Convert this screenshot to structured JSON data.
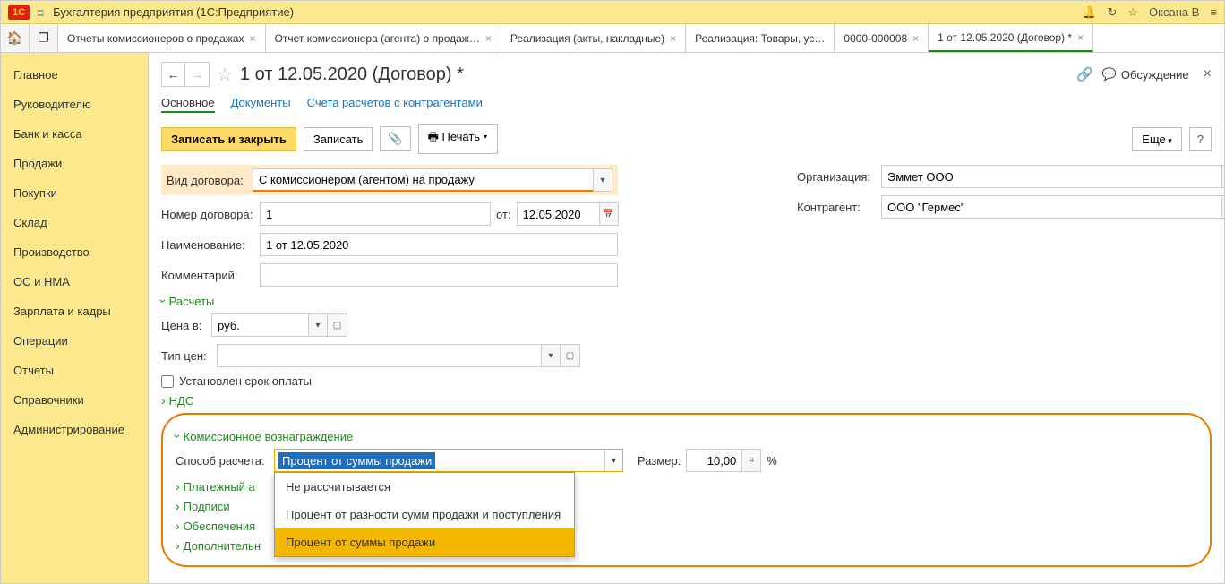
{
  "top": {
    "title": "Бухгалтерия предприятия  (1С:Предприятие)",
    "user": "Оксана В"
  },
  "tabs": [
    {
      "label": "Отчеты комиссионеров о продажах"
    },
    {
      "label": "Отчет комиссионера (агента) о продаж…"
    },
    {
      "label": "Реализация (акты, накладные)"
    },
    {
      "label": "Реализация: Товары, ус…"
    },
    {
      "label": "0000-000008"
    },
    {
      "label": "1 от 12.05.2020 (Договор) *"
    }
  ],
  "nav": [
    "Главное",
    "Руководителю",
    "Банк и касса",
    "Продажи",
    "Покупки",
    "Склад",
    "Производство",
    "ОС и НМА",
    "Зарплата и кадры",
    "Операции",
    "Отчеты",
    "Справочники",
    "Администрирование"
  ],
  "page": {
    "title": "1 от 12.05.2020 (Договор) *",
    "discuss": "Обсуждение"
  },
  "subtabs": {
    "main": "Основное",
    "docs": "Документы",
    "accounts": "Счета расчетов с контрагентами"
  },
  "toolbar": {
    "save_close": "Записать и закрыть",
    "save": "Записать",
    "print": "Печать",
    "more": "Еще"
  },
  "labels": {
    "contract_type": "Вид договора:",
    "org": "Организация:",
    "number": "Номер договора:",
    "from": "от:",
    "counterparty": "Контрагент:",
    "name": "Наименование:",
    "comment": "Комментарий:",
    "calc": "Расчеты",
    "price_in": "Цена в:",
    "price_type": "Тип цен:",
    "due_set": "Установлен срок оплаты",
    "vat": "НДС",
    "commission": "Комиссионное вознаграждение",
    "method": "Способ расчета:",
    "amount": "Размер:",
    "pct": "%",
    "pay": "Платежный а",
    "sign": "Подписи",
    "provision": "Обеспечения",
    "extra": "Дополнительн"
  },
  "values": {
    "contract_type": "С комиссионером (агентом) на продажу",
    "org": "Эммет ООО",
    "number": "1",
    "date": "12.05.2020",
    "counterparty": "ООО \"Гермес\"",
    "name": "1 от 12.05.2020",
    "currency": "руб.",
    "method": "Процент от суммы продажи",
    "amount": "10,00"
  },
  "dropdown": [
    "Не рассчитывается",
    "Процент от разности сумм продажи и поступления",
    "Процент от суммы продажи"
  ]
}
